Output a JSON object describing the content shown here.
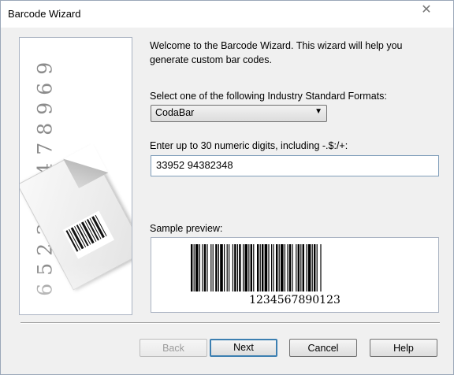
{
  "window": {
    "title": "Barcode Wizard",
    "close_glyph": "✕"
  },
  "left_panel": {
    "digits": [
      "9",
      "6",
      "9",
      "8",
      "7",
      "4",
      "5",
      "6",
      "3",
      "2",
      "5",
      "6"
    ],
    "leaf_icon": "barcode-paper"
  },
  "intro_text": "Welcome to the Barcode Wizard.  This wizard will help you generate custom bar codes.",
  "format": {
    "label": "Select one of the following Industry Standard Formats:",
    "selected": "CodaBar"
  },
  "digits_field": {
    "label": "Enter up to 30 numeric digits, including -.$:/+:",
    "value": "33952 94382348"
  },
  "preview": {
    "label": "Sample preview:",
    "sample_text": "1234567890123"
  },
  "buttons": {
    "back": "Back",
    "next": "Next",
    "cancel": "Cancel",
    "help": "Help"
  }
}
